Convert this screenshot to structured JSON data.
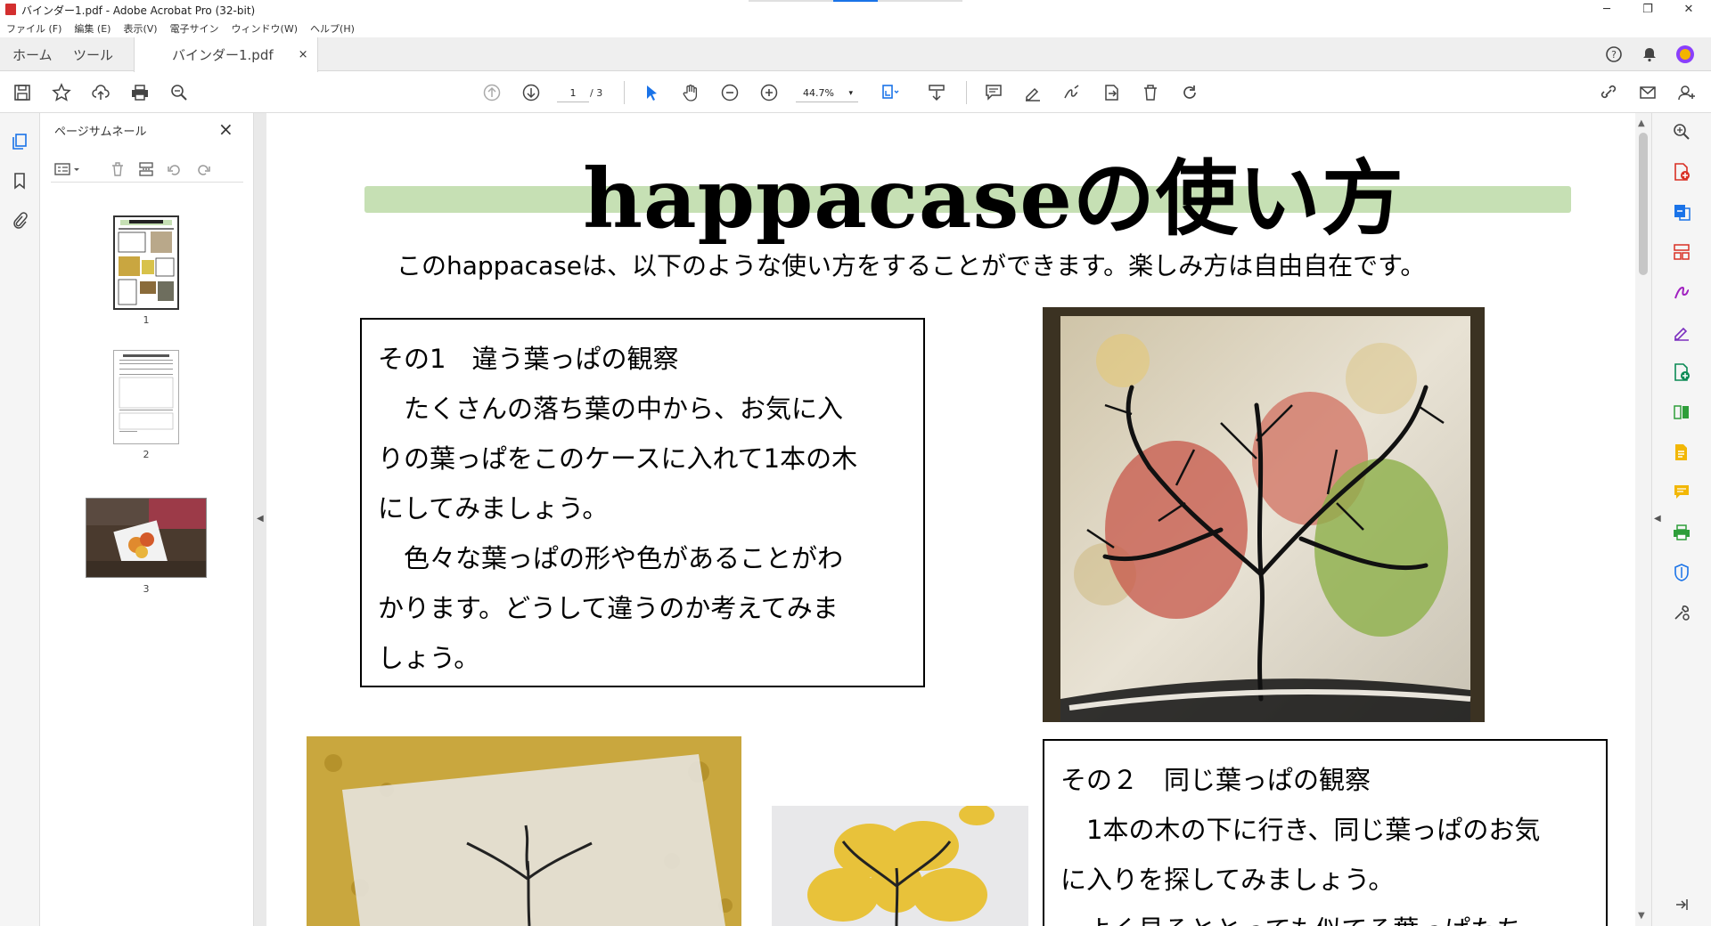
{
  "window": {
    "title": "バインダー1.pdf - Adobe Acrobat Pro (32-bit)"
  },
  "menu": [
    "ファイル (F)",
    "編集 (E)",
    "表示(V)",
    "電子サイン",
    "ウィンドウ(W)",
    "ヘルプ(H)"
  ],
  "tabs": {
    "home": "ホーム",
    "tools": "ツール",
    "doc": "バインダー1.pdf",
    "close": "×"
  },
  "toolbar": {
    "page_current": "1",
    "page_total": "/ 3",
    "zoom": "44.7%",
    "zoom_caret": "▾"
  },
  "panel": {
    "title": "ページサムネール",
    "close": "×",
    "thumbs": [
      {
        "num": "1"
      },
      {
        "num": "2"
      },
      {
        "num": "3"
      }
    ]
  },
  "document": {
    "title": "happacaseの使い方",
    "intro": "このhappacaseは、以下のような使い方をすることができます。楽しみ方は自由自在です。",
    "box1": {
      "heading": "その1　違う葉っぱの観察",
      "lines": [
        "　たくさんの落ち葉の中から、お気に入",
        "りの葉っぱをこのケースに入れて1本の木",
        "にしてみましょう。",
        "　色々な葉っぱの形や色があることがわ",
        "かります。どうして違うのか考えてみま",
        "しょう。"
      ]
    },
    "box2": {
      "heading": "その２　同じ葉っぱの観察",
      "lines": [
        "　1本の木の下に行き、同じ葉っぱのお気",
        "に入りを探してみましょう。",
        "　よく見るととっても似てる葉っぱたち"
      ]
    }
  },
  "colors": {
    "title_band": "#c6e0b4",
    "accent": "#1a73e8"
  }
}
